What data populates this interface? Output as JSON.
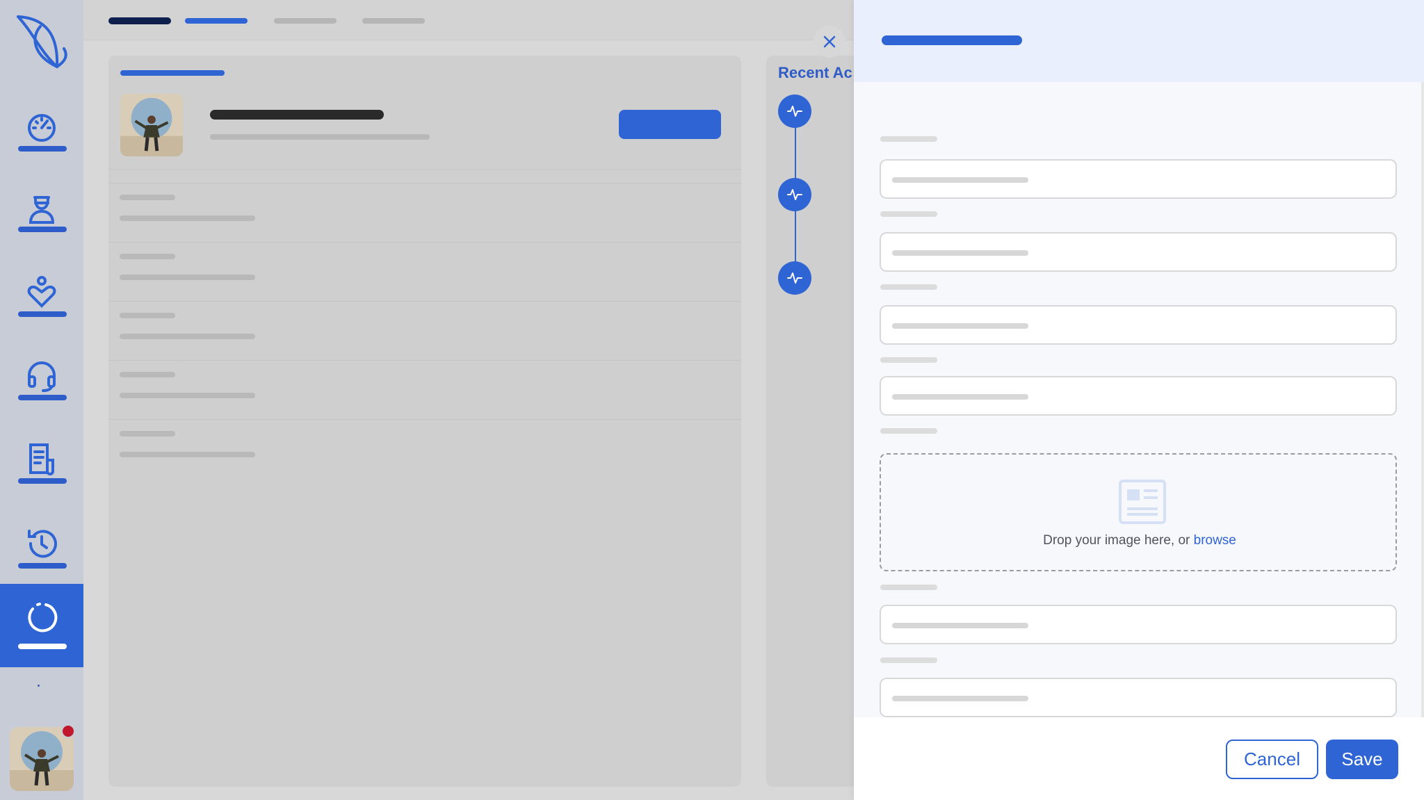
{
  "app": {
    "accent_color": "#2f64d4",
    "notification_color": "#c0172e"
  },
  "sidebar": {
    "logo": "leaf-logo",
    "items": [
      {
        "icon": "dashboard-gauge-icon",
        "active": false
      },
      {
        "icon": "doctor-icon",
        "active": false
      },
      {
        "icon": "heart-care-icon",
        "active": false
      },
      {
        "icon": "headset-support-icon",
        "active": false
      },
      {
        "icon": "document-report-icon",
        "active": false
      },
      {
        "icon": "history-icon",
        "active": false
      },
      {
        "icon": "loading-spinner-icon",
        "active": true
      }
    ],
    "user_has_notification": true
  },
  "activity": {
    "title": "Recent Ac",
    "items": [
      {
        "icon": "activity-pulse-icon"
      },
      {
        "icon": "activity-pulse-icon"
      },
      {
        "icon": "activity-pulse-icon"
      }
    ]
  },
  "drawer": {
    "field_count": 6,
    "dropzone": {
      "icon": "image-placeholder-icon",
      "text": "Drop your image here, or ",
      "link": "browse"
    },
    "buttons": {
      "cancel": "Cancel",
      "save": "Save"
    }
  }
}
